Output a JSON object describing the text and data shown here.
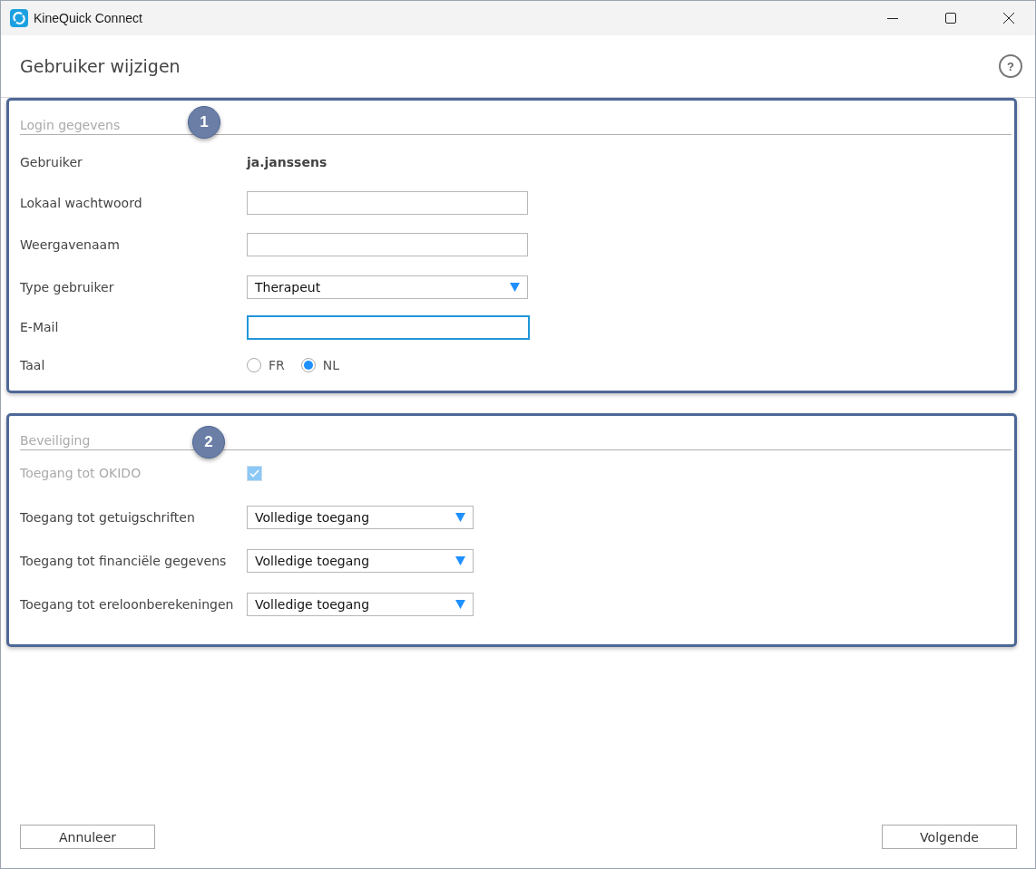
{
  "window": {
    "title": "KineQuick Connect"
  },
  "header": {
    "title": "Gebruiker wijzigen",
    "help": "?"
  },
  "sections": [
    {
      "title": "Login gegevens",
      "badge": "1",
      "rows": [
        {
          "kind": "text",
          "label": "Gebruiker",
          "value": "ja.janssens"
        },
        {
          "kind": "input",
          "label": "Lokaal wachtwoord",
          "focused": false
        },
        {
          "kind": "input",
          "label": "Weergavenaam",
          "focused": false
        },
        {
          "kind": "select",
          "label": "Type gebruiker",
          "value": "Therapeut"
        },
        {
          "kind": "input",
          "label": "E-Mail",
          "focused": true
        },
        {
          "kind": "radio",
          "label": "Taal",
          "options": [
            {
              "label": "FR",
              "selected": false
            },
            {
              "label": "NL",
              "selected": true
            }
          ]
        }
      ]
    },
    {
      "title": "Beveiliging",
      "badge": "2",
      "rows": [
        {
          "kind": "checkbox",
          "label": "Toegang tot OKIDO",
          "checked": true,
          "disabled": true
        },
        {
          "kind": "select",
          "label": "Toegang tot getuigschriften",
          "value": "Volledige toegang"
        },
        {
          "kind": "select",
          "label": "Toegang tot financiële gegevens",
          "value": "Volledige toegang"
        },
        {
          "kind": "select",
          "label": "Toegang tot ereloonberekeningen",
          "value": "Volledige toegang"
        }
      ]
    }
  ],
  "buttons": [
    {
      "label": "Annuleer"
    },
    {
      "label": "Volgende"
    }
  ]
}
